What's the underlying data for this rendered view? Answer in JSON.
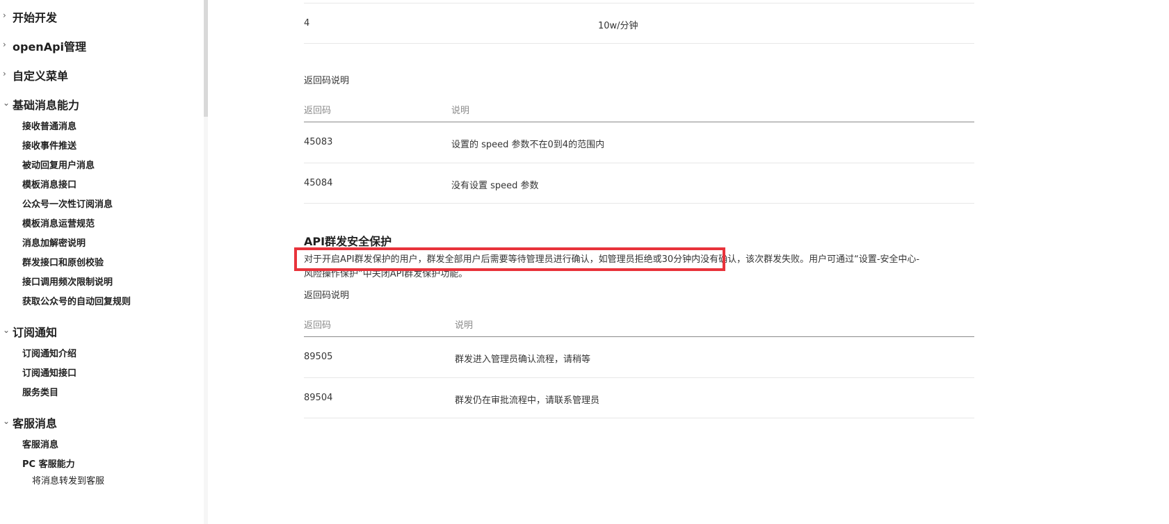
{
  "sidebar": {
    "groups": [
      {
        "label": "开始开发"
      },
      {
        "label": "openApi管理"
      },
      {
        "label": "自定义菜单"
      },
      {
        "label": "基础消息能力"
      },
      {
        "label": "订阅通知"
      },
      {
        "label": "客服消息"
      }
    ],
    "basic_items": [
      "接收普通消息",
      "接收事件推送",
      "被动回复用户消息",
      "模板消息接口",
      "公众号一次性订阅消息",
      "模板消息运营规范",
      "消息加解密说明",
      "群发接口和原创校验",
      "接口调用频次限制说明",
      "获取公众号的自动回复规则"
    ],
    "subscribe_items": [
      "订阅通知介绍",
      "订阅通知接口",
      "服务类目"
    ],
    "kf_items": [
      "客服消息",
      "PC 客服能力"
    ],
    "kf_sub_items": [
      "将消息转发到客服"
    ]
  },
  "content": {
    "speed_row": {
      "col1": "4",
      "col2": "10w/分钟"
    },
    "return_code_label_1": "返回码说明",
    "table1": {
      "headers": [
        "返回码",
        "说明"
      ],
      "rows": [
        {
          "code": "45083",
          "desc": "设置的 speed 参数不在0到4的范围内"
        },
        {
          "code": "45084",
          "desc": "没有设置 speed 参数"
        }
      ]
    },
    "section_title": "API群发安全保护",
    "paragraph_line1": "对于开启API群发保护的用户，群发全部用户后需要等待管理员进行确认，如管理员拒绝或30分钟内没有确认，该次群发失败。用户可通过“设置-安全中心-",
    "paragraph_line2": "风险操作保护”中关闭API群发保护功能。",
    "return_code_label_2": "返回码说明",
    "table2": {
      "headers": [
        "返回码",
        "说明"
      ],
      "rows": [
        {
          "code": "89505",
          "desc": "群发进入管理员确认流程，请稍等"
        },
        {
          "code": "89504",
          "desc": "群发仍在审批流程中，请联系管理员"
        }
      ]
    }
  },
  "colors": {
    "highlight": "#e8333b"
  }
}
